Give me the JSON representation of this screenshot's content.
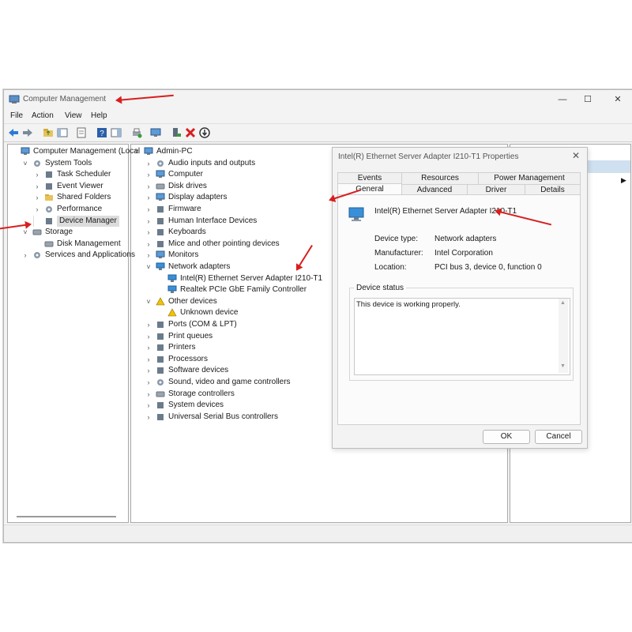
{
  "window": {
    "title": "Computer Management",
    "controls": [
      "—",
      "☐",
      "✕"
    ],
    "menu": [
      "File",
      "Action",
      "View",
      "Help"
    ]
  },
  "left_tree": [
    {
      "label": "Computer Management (Local",
      "chev": "",
      "indent": 0
    },
    {
      "label": "System Tools",
      "chev": "˅",
      "indent": 1
    },
    {
      "label": "Task Scheduler",
      "chev": "›",
      "indent": 2
    },
    {
      "label": "Event Viewer",
      "chev": "›",
      "indent": 2
    },
    {
      "label": "Shared Folders",
      "chev": "›",
      "indent": 2
    },
    {
      "label": "Performance",
      "chev": "›",
      "indent": 2
    },
    {
      "label": "Device Manager",
      "chev": "",
      "indent": 2,
      "selected": true
    },
    {
      "label": "Storage",
      "chev": "˅",
      "indent": 1
    },
    {
      "label": "Disk Management",
      "chev": "",
      "indent": 2
    },
    {
      "label": "Services and Applications",
      "chev": "›",
      "indent": 1
    }
  ],
  "device_tree": [
    {
      "label": "Admin-PC",
      "chev": "˅",
      "indent": 0
    },
    {
      "label": "Audio inputs and outputs",
      "chev": "›",
      "indent": 1
    },
    {
      "label": "Computer",
      "chev": "›",
      "indent": 1
    },
    {
      "label": "Disk drives",
      "chev": "›",
      "indent": 1
    },
    {
      "label": "Display adapters",
      "chev": "›",
      "indent": 1
    },
    {
      "label": "Firmware",
      "chev": "›",
      "indent": 1
    },
    {
      "label": "Human Interface Devices",
      "chev": "›",
      "indent": 1
    },
    {
      "label": "Keyboards",
      "chev": "›",
      "indent": 1
    },
    {
      "label": "Mice and other pointing devices",
      "chev": "›",
      "indent": 1
    },
    {
      "label": "Monitors",
      "chev": "›",
      "indent": 1
    },
    {
      "label": "Network adapters",
      "chev": "˅",
      "indent": 1
    },
    {
      "label": "Intel(R) Ethernet Server Adapter I210-T1",
      "chev": "",
      "indent": 2
    },
    {
      "label": "Realtek PCIe GbE Family Controller",
      "chev": "",
      "indent": 2
    },
    {
      "label": "Other devices",
      "chev": "˅",
      "indent": 1
    },
    {
      "label": "Unknown device",
      "chev": "",
      "indent": 2
    },
    {
      "label": "Ports (COM & LPT)",
      "chev": "›",
      "indent": 1
    },
    {
      "label": "Print queues",
      "chev": "›",
      "indent": 1
    },
    {
      "label": "Printers",
      "chev": "›",
      "indent": 1
    },
    {
      "label": "Processors",
      "chev": "›",
      "indent": 1
    },
    {
      "label": "Software devices",
      "chev": "›",
      "indent": 1
    },
    {
      "label": "Sound, video and game controllers",
      "chev": "›",
      "indent": 1
    },
    {
      "label": "Storage controllers",
      "chev": "›",
      "indent": 1
    },
    {
      "label": "System devices",
      "chev": "›",
      "indent": 1
    },
    {
      "label": "Universal Serial Bus controllers",
      "chev": "›",
      "indent": 1
    }
  ],
  "dialog": {
    "title": "Intel(R) Ethernet Server Adapter I210-T1 Properties",
    "close": "✕",
    "tabs_row1": [
      "Events",
      "Resources",
      "Power Management"
    ],
    "tabs_row2": [
      "General",
      "Advanced",
      "Driver",
      "Details"
    ],
    "active_tab": "General",
    "device_name": "Intel(R) Ethernet Server Adapter I210-T1",
    "device_type_label": "Device type:",
    "device_type": "Network adapters",
    "manufacturer_label": "Manufacturer:",
    "manufacturer": "Intel Corporation",
    "location_label": "Location:",
    "location": "PCI bus 3, device 0, function 0",
    "status_group": "Device status",
    "status_text": "This device is working properly.",
    "ok": "OK",
    "cancel": "Cancel"
  },
  "colors": {
    "annotation_arrow": "#d81e1e",
    "selection": "#dcdcdc",
    "accent_blue": "#2b7bd6"
  }
}
